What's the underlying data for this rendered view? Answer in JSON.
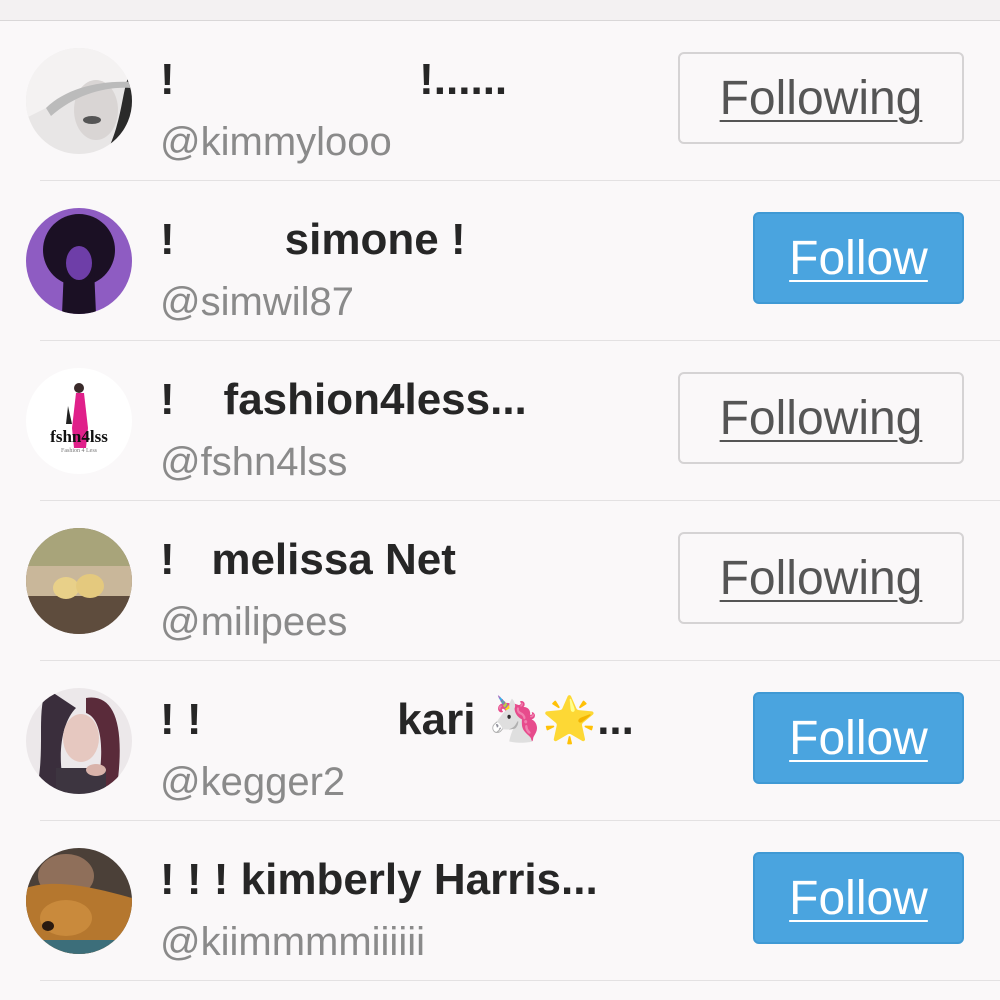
{
  "colors": {
    "follow_button": "#4aa4df",
    "following_border": "#d5d3d4",
    "name_text": "#262626",
    "handle_text": "#8a8a8a"
  },
  "users": [
    {
      "name": "!                    !......",
      "handle": "@kimmylooo",
      "button": "Following",
      "avatar_icon": "woman-hat-photo"
    },
    {
      "name": "!         simone !",
      "handle": "@simwil87",
      "button": "Follow",
      "avatar_icon": "afro-silhouette"
    },
    {
      "name": "!    fashion4less...",
      "handle": "@fshn4lss",
      "button": "Following",
      "avatar_icon": "fshn4lss-logo",
      "avatar_logo_text": "fshn4lss",
      "avatar_logo_sub": "Fashion 4 Less"
    },
    {
      "name": "!   melissa Net",
      "handle": "@milipees",
      "button": "Following",
      "avatar_icon": "chicks-photo"
    },
    {
      "name": "! !                kari 🦄🌟...",
      "handle": "@kegger2",
      "button": "Follow",
      "avatar_icon": "woman-photo"
    },
    {
      "name": "! ! ! kimberly Harris...",
      "handle": "@kiimmmmiiiiii",
      "button": "Follow",
      "avatar_icon": "dog-photo"
    }
  ]
}
